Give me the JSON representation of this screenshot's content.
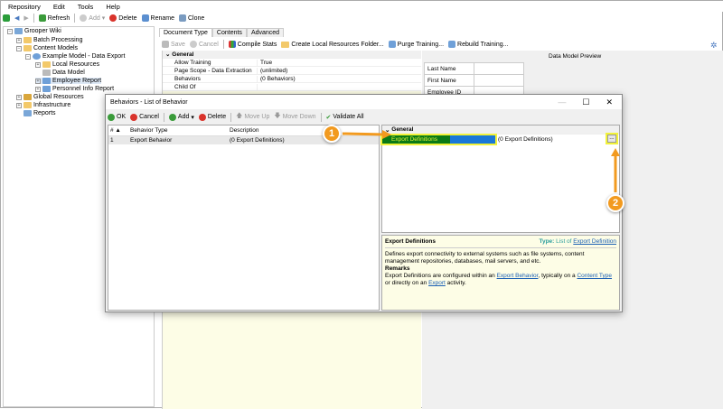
{
  "menu": [
    "Repository",
    "Edit",
    "Tools",
    "Help"
  ],
  "toolbar": {
    "refresh": "Refresh",
    "add": "Add",
    "delete": "Delete",
    "rename": "Rename",
    "clone": "Clone"
  },
  "tree": [
    {
      "label": "Grooper Wiki",
      "level": 0
    },
    {
      "label": "Batch Processing",
      "level": 1
    },
    {
      "label": "Content Models",
      "level": 1
    },
    {
      "label": "Example Model - Data Export",
      "level": 2
    },
    {
      "label": "Local Resources",
      "level": 3
    },
    {
      "label": "Data Model",
      "level": 3
    },
    {
      "label": "Employee Report",
      "level": 3,
      "selected": true
    },
    {
      "label": "Personnel Info Report",
      "level": 3
    },
    {
      "label": "Global Resources",
      "level": 1
    },
    {
      "label": "Infrastructure",
      "level": 1
    },
    {
      "label": "Reports",
      "level": 1
    }
  ],
  "tabs": [
    "Document Type",
    "Contents",
    "Advanced"
  ],
  "doc_toolbar": {
    "save": "Save",
    "cancel": "Cancel",
    "compile": "Compile Stats",
    "create_folder": "Create Local Resources Folder...",
    "purge": "Purge Training...",
    "rebuild": "Rebuild Training..."
  },
  "props": {
    "section": "General",
    "rows": [
      {
        "k": "Allow Training",
        "v": "True"
      },
      {
        "k": "Page Scope - Data Extraction",
        "v": "(unlimited)"
      },
      {
        "k": "Behaviors",
        "v": "(0 Behaviors)"
      },
      {
        "k": "Child Of",
        "v": ""
      }
    ]
  },
  "preview": {
    "title": "Data Model Preview",
    "fields": [
      "Last Name",
      "First Name",
      "Employee ID"
    ]
  },
  "dialog": {
    "title": "Behaviors - List of Behavior",
    "toolbar": {
      "ok": "OK",
      "cancel": "Cancel",
      "add": "Add",
      "delete": "Delete",
      "move_up": "Move Up",
      "move_down": "Move Down",
      "validate": "Validate All"
    },
    "columns": [
      "# ▲",
      "Behavior Type",
      "Description"
    ],
    "rows": [
      {
        "n": "1",
        "type": "Export Behavior",
        "desc": "(0 Export Definitions)"
      }
    ],
    "grid": {
      "section": "General",
      "prop": "Export Definitions",
      "value": "(0 Export Definitions)",
      "button": "..."
    },
    "help": {
      "title": "Export Definitions",
      "type_label": "Type:",
      "type_prefix": "List of",
      "type_link": "Export Definition",
      "desc": "Defines export connectivity to external systems such as file systems, content management repositories, databases, mail servers, and etc.",
      "remarks_title": "Remarks",
      "r1": "Export Definitions are configured within an",
      "l1": "Export Behavior",
      "r2": ", typically on a",
      "l2": "Content Type",
      "r3": "or directly on an",
      "l3": "Export",
      "r4": "activity."
    }
  },
  "callouts": [
    "1",
    "2"
  ]
}
